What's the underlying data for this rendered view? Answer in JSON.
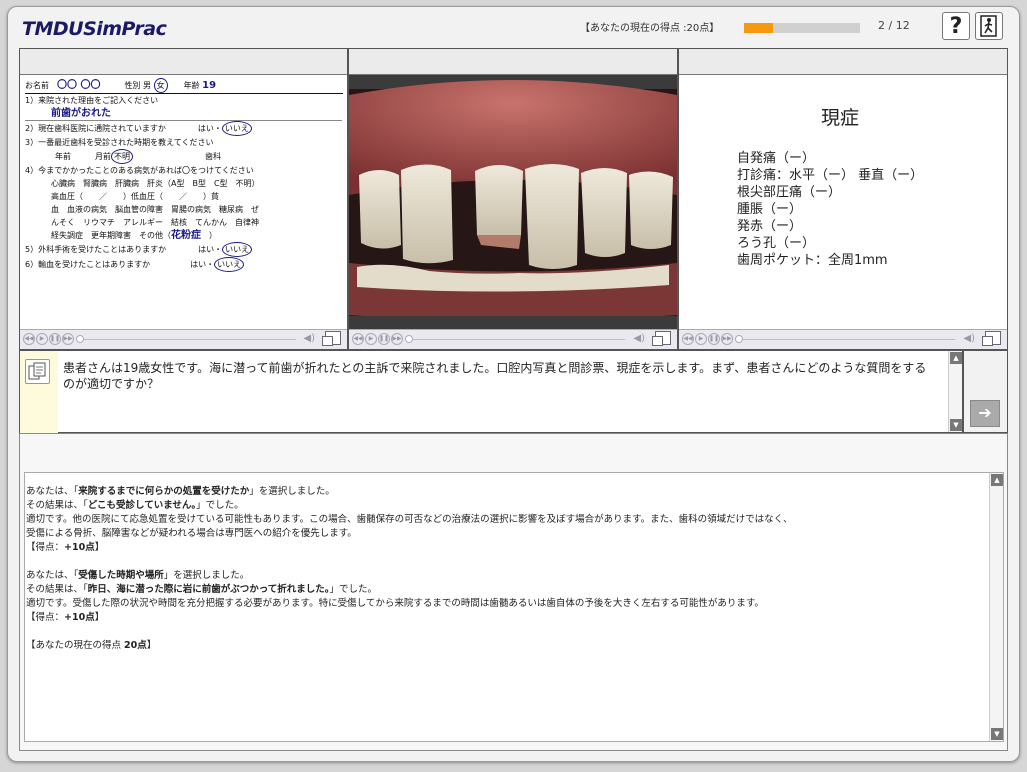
{
  "header": {
    "logo": "TMDUSimPrac",
    "score_label": "【あなたの現在の得点 :20点】",
    "progress_fraction": 0.25,
    "page": "2 / 12",
    "help_label": "?",
    "accent_color": "#f59a0f"
  },
  "questionnaire": {
    "name_label": "お名前",
    "name_value": "〇〇 〇〇",
    "sex_label": "性別",
    "male": "男",
    "female": "女",
    "age_label": "年齢",
    "age_value": "19",
    "q1": "1）来院された理由をご記入ください",
    "q1_answer": "前歯がおれた",
    "q2": "2）現在歯科医院に通院されていますか",
    "q2_yes": "はい",
    "q2_no": "いいえ",
    "q3": "3）一番最近歯科を受診された時期を教えてください",
    "q3_year": "年前",
    "q3_month": "月前",
    "q3_unknown": "不明",
    "q3_dental": "歯科",
    "q4": "4）今までかかったことのある病気があれば〇をつけてください",
    "q4_l1": "心臓病　腎臓病　肝臓病　肝炎（A型　B型　C型　不明）",
    "q4_l2": "高血圧（　　／　　）低血圧（　　／　　）貧",
    "q4_l3": "血　血液の病気　脳血管の障害　胃腸の病気　糖尿病　ぜ",
    "q4_l4": "んそく　リウマチ　アレルギー　結核　てんかん　自律神",
    "q4_l5": "経失調症　更年期障害　その他（",
    "q4_other": "花粉症",
    "q5": "5）外科手術を受けたことはありますか",
    "q5_yes": "はい",
    "q5_no": "いいえ",
    "q6": "6）輸血を受けたことはありますか",
    "q6_yes": "はい",
    "q6_no": "いいえ"
  },
  "findings": {
    "title": "現症",
    "items": [
      "自発痛（ー）",
      "打診痛：水平（ー） 垂直（ー）",
      "根尖部圧痛（ー）",
      "腫脹（ー）",
      "発赤（ー）",
      "ろう孔（ー）",
      "歯周ポケット：全周1mm"
    ]
  },
  "question": {
    "text": "患者さんは19歳女性です。海に潜って前歯が折れたとの主訴で来院されました。口腔内写真と問診票、現症を示します。まず、患者さんにどのような質問をするのが適切ですか？"
  },
  "feedback": {
    "b1_pre": "あなたは、「",
    "b1_choice": "来院するまでに何らかの処置を受けたか",
    "b1_post": "」を選択しました。",
    "b1_r_pre": "その結果は、「",
    "b1_result": "どこも受診していません。",
    "b1_r_post": "」でした。",
    "b1_exp1": "適切です。他の医院にて応急処置を受けている可能性もあります。この場合、歯髄保存の可否などの治療法の選択に影響を及ぼす場合があります。また、歯科の領域だけではなく、",
    "b1_exp2": "受傷による骨折、脳障害などが疑われる場合は専門医への紹介を優先します。",
    "b1_score_pre": "【得点：",
    "b1_score": "+10点",
    "b1_score_post": "】",
    "b2_pre": "あなたは、「",
    "b2_choice": "受傷した時期や場所",
    "b2_post": "」を選択しました。",
    "b2_r_pre": "その結果は、「",
    "b2_result": "昨日、海に潜った際に岩に前歯がぶつかって折れました。",
    "b2_r_post": "」でした。",
    "b2_exp1": "適切です。受傷した際の状況や時間を充分把握する必要があります。特に受傷してから来院するまでの時間は歯髄あるいは歯自体の予後を大きく左右する可能性があります。",
    "b2_score_pre": "【得点：",
    "b2_score": "+10点",
    "b2_score_post": "】",
    "total_pre": "【あなたの現在の得点",
    "total": "20点",
    "total_post": "】"
  }
}
